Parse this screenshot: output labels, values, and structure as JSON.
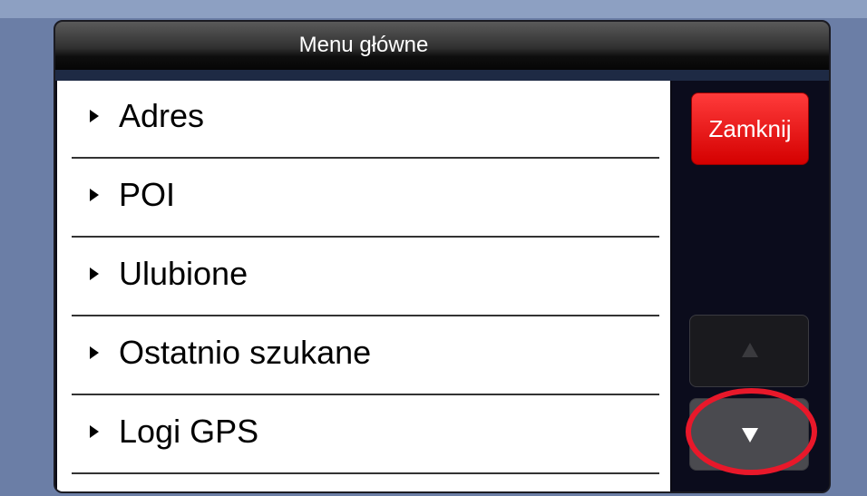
{
  "header": {
    "title": "Menu główne"
  },
  "menu": {
    "items": [
      {
        "label": "Adres"
      },
      {
        "label": "POI"
      },
      {
        "label": "Ulubione"
      },
      {
        "label": "Ostatnio szukane"
      },
      {
        "label": "Logi GPS"
      }
    ]
  },
  "side": {
    "close_label": "Zamknij",
    "scroll_up_icon": "triangle-up-icon",
    "scroll_down_icon": "triangle-down-icon",
    "scroll_up_enabled": false,
    "scroll_down_enabled": true
  },
  "colors": {
    "close_button": "#e01010",
    "highlight_ring": "#e8182a",
    "background": "#6b7ea6"
  }
}
